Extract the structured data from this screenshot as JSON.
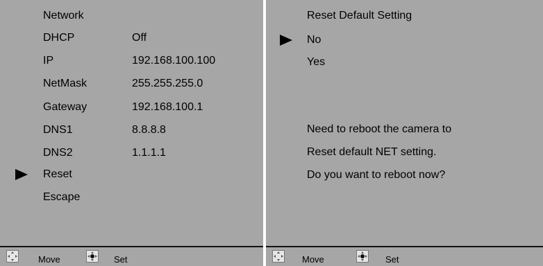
{
  "left": {
    "title": "Network",
    "rows": [
      {
        "label": "DHCP",
        "value": "Off"
      },
      {
        "label": "IP",
        "value": "192.168.100.100"
      },
      {
        "label": "NetMask",
        "value": "255.255.255.0"
      },
      {
        "label": "Gateway",
        "value": "192.168.100.1"
      },
      {
        "label": "DNS1",
        "value": "8.8.8.8"
      },
      {
        "label": "DNS2",
        "value": "1.1.1.1"
      },
      {
        "label": "Reset",
        "value": ""
      },
      {
        "label": "Escape",
        "value": ""
      }
    ],
    "selected_item": "Reset"
  },
  "right": {
    "title": "Reset Default Setting",
    "options": [
      "No",
      "Yes"
    ],
    "selected_option": "No",
    "message": [
      "Need to reboot the camera to",
      "Reset default NET setting.",
      "Do you want to reboot now?"
    ]
  },
  "footer": {
    "move_label": "Move",
    "set_label": "Set",
    "move_icon": "dpad-arrows-icon",
    "set_icon": "dpad-center-icon"
  },
  "colors": {
    "background": "#a6a6a6",
    "separator": "#ffffff",
    "text": "#000000"
  }
}
